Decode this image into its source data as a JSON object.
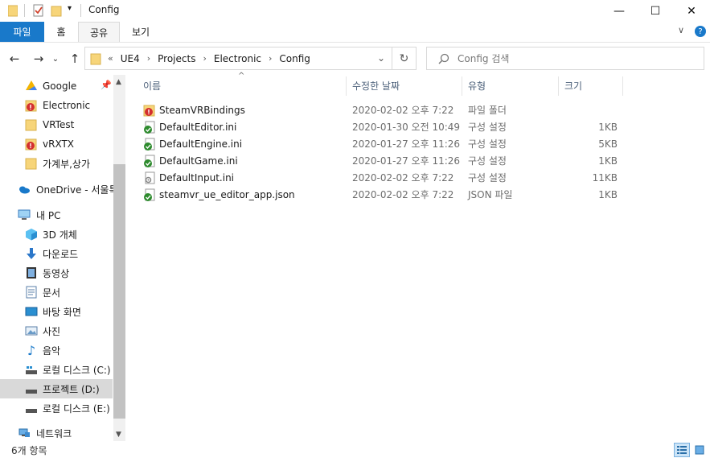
{
  "window": {
    "title": "Config",
    "buttons": {
      "minimize": "—",
      "maximize": "☐",
      "close": "✕"
    }
  },
  "ribbon": {
    "tabs": [
      "파일",
      "홈",
      "공유",
      "보기"
    ],
    "collapse_icon": "chevron-down-icon",
    "help_icon": "help-icon"
  },
  "address": {
    "overflow": "«",
    "crumbs": [
      "UE4",
      "Projects",
      "Electronic",
      "Config"
    ],
    "separator": "›"
  },
  "search": {
    "placeholder": "Config 검색"
  },
  "nav": {
    "items": [
      {
        "label": "Google",
        "icon": "google-drive-icon"
      },
      {
        "label": "Electronic",
        "icon": "folder-warning-icon"
      },
      {
        "label": "VRTest",
        "icon": "folder-icon"
      },
      {
        "label": "vRXTX",
        "icon": "folder-warning-icon"
      },
      {
        "label": "가계부,상가",
        "icon": "folder-icon"
      },
      {
        "label": "OneDrive - 서울특",
        "icon": "onedrive-icon"
      },
      {
        "label": "내 PC",
        "icon": "pc-icon"
      },
      {
        "label": "3D 개체",
        "icon": "3d-objects-icon"
      },
      {
        "label": "다운로드",
        "icon": "download-icon"
      },
      {
        "label": "동영상",
        "icon": "video-icon"
      },
      {
        "label": "문서",
        "icon": "documents-icon"
      },
      {
        "label": "바탕 화면",
        "icon": "desktop-icon"
      },
      {
        "label": "사진",
        "icon": "pictures-icon"
      },
      {
        "label": "음악",
        "icon": "music-icon"
      },
      {
        "label": "로컬 디스크 (C:)",
        "icon": "drive-icon"
      },
      {
        "label": "프로젝트 (D:)",
        "icon": "drive-icon",
        "selected": true
      },
      {
        "label": "로컬 디스크 (E:)",
        "icon": "drive-icon"
      },
      {
        "label": "네트워크",
        "icon": "network-icon"
      }
    ]
  },
  "list": {
    "columns": [
      "이름",
      "수정한 날짜",
      "유형",
      "크기"
    ],
    "rows": [
      {
        "name": "SteamVRBindings",
        "date": "2020-02-02 오후 7:22",
        "type": "파일 폴더",
        "size": "",
        "icon": "folder-warning-icon"
      },
      {
        "name": "DefaultEditor.ini",
        "date": "2020-01-30 오전 10:49",
        "type": "구성 설정",
        "size": "1KB",
        "icon": "file-synced-icon"
      },
      {
        "name": "DefaultEngine.ini",
        "date": "2020-01-27 오후 11:26",
        "type": "구성 설정",
        "size": "5KB",
        "icon": "file-synced-icon"
      },
      {
        "name": "DefaultGame.ini",
        "date": "2020-01-27 오후 11:26",
        "type": "구성 설정",
        "size": "1KB",
        "icon": "file-synced-icon"
      },
      {
        "name": "DefaultInput.ini",
        "date": "2020-02-02 오후 7:22",
        "type": "구성 설정",
        "size": "11KB",
        "icon": "file-settings-icon"
      },
      {
        "name": "steamvr_ue_editor_app.json",
        "date": "2020-02-02 오후 7:22",
        "type": "JSON 파일",
        "size": "1KB",
        "icon": "file-synced-icon"
      }
    ]
  },
  "status": {
    "count": "6개 항목"
  },
  "colors": {
    "accent": "#1979ca",
    "header_text": "#4c607a",
    "folder": "#f7d57a",
    "sync_green": "#2e8b2e",
    "warning_red": "#d32f2f"
  }
}
